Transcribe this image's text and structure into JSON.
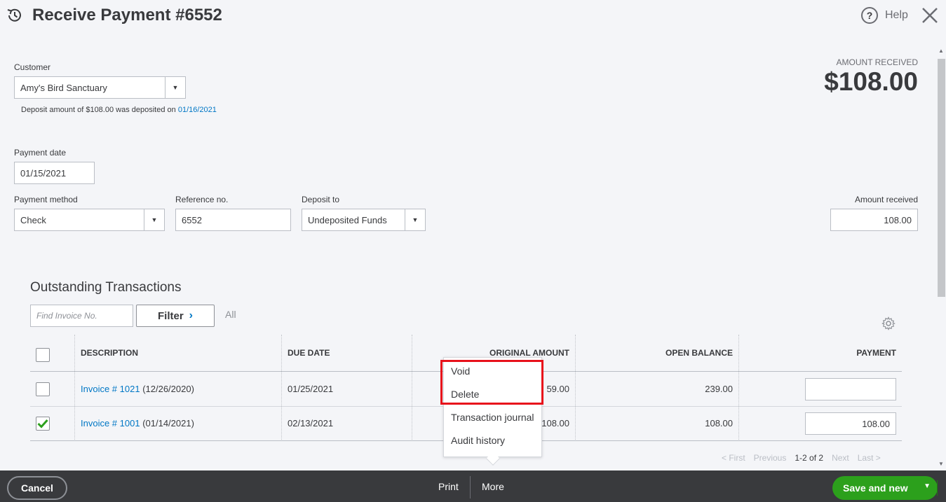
{
  "header": {
    "title": "Receive Payment #6552",
    "help_label": "Help"
  },
  "customer": {
    "label": "Customer",
    "value": "Amy's Bird Sanctuary",
    "deposit_note": "Deposit amount of $108.00 was deposited on",
    "deposit_date": "01/16/2021"
  },
  "amount_received": {
    "label": "AMOUNT RECEIVED",
    "value": "$108.00"
  },
  "payment_date": {
    "label": "Payment date",
    "value": "01/15/2021"
  },
  "payment_method": {
    "label": "Payment method",
    "value": "Check"
  },
  "reference": {
    "label": "Reference no.",
    "value": "6552"
  },
  "deposit_to": {
    "label": "Deposit to",
    "value": "Undeposited Funds"
  },
  "amount_field": {
    "label": "Amount received",
    "value": "108.00"
  },
  "outstanding": {
    "title": "Outstanding Transactions",
    "find_placeholder": "Find Invoice No.",
    "filter_label": "Filter",
    "all_label": "All",
    "columns": [
      "DESCRIPTION",
      "DUE DATE",
      "ORIGINAL AMOUNT",
      "OPEN BALANCE",
      "PAYMENT"
    ],
    "rows": [
      {
        "invoice": "Invoice # 1021",
        "date": " (12/26/2020)",
        "due": "01/25/2021",
        "original": "59.00",
        "balance": "239.00",
        "payment": "",
        "checked": false
      },
      {
        "invoice": "Invoice # 1001",
        "date": " (01/14/2021)",
        "due": "02/13/2021",
        "original": "108.00",
        "balance": "108.00",
        "payment": "108.00",
        "checked": true
      }
    ],
    "pager": {
      "first": "< First",
      "previous": "Previous",
      "range": "1-2 of 2",
      "next": "Next",
      "last": "Last >"
    }
  },
  "more_menu": {
    "items": [
      "Void",
      "Delete",
      "Transaction journal",
      "Audit history"
    ]
  },
  "footer": {
    "cancel": "Cancel",
    "print": "Print",
    "more": "More",
    "save": "Save and new"
  },
  "colors": {
    "accent_green": "#2ca01c",
    "link_blue": "#0077c5",
    "footer_bg": "#393a3d",
    "highlight_red": "#e8111b"
  }
}
